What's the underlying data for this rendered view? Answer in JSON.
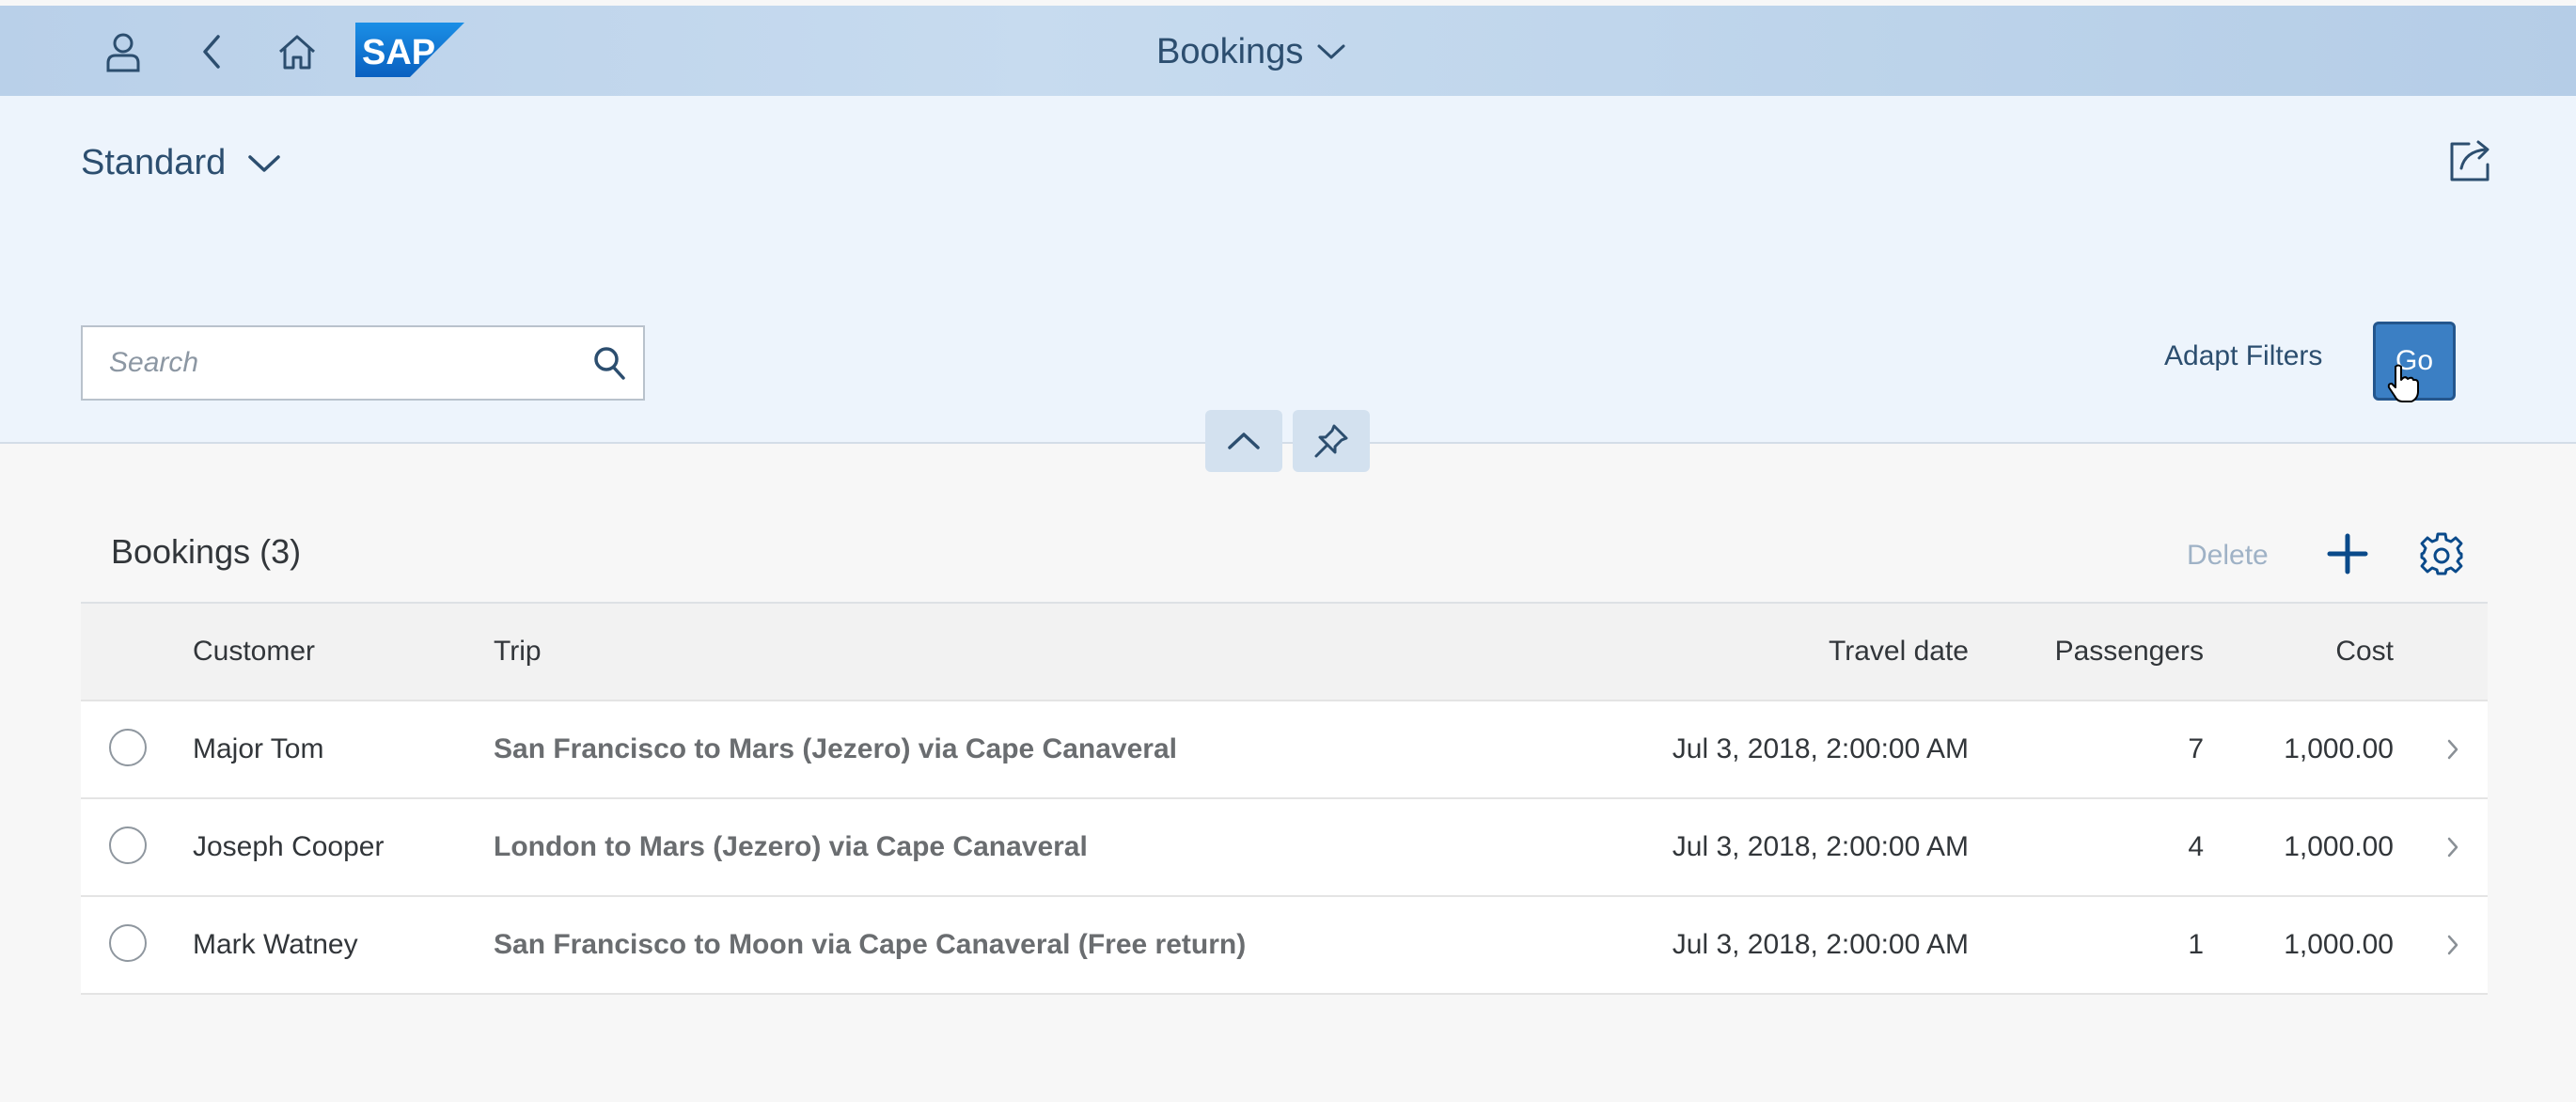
{
  "shell": {
    "logo_text": "SAP",
    "title": "Bookings",
    "icons": {
      "user": "user-icon",
      "back": "back-icon",
      "home": "home-icon",
      "title_dropdown": "chevron-down-icon"
    }
  },
  "header": {
    "variant_label": "Standard",
    "share_icon": "share-icon",
    "search": {
      "placeholder": "Search",
      "value": ""
    },
    "adapt_filters_label": "Adapt Filters",
    "go_label": "Go",
    "collapse_icon": "chevron-up-icon",
    "pin_icon": "pin-icon"
  },
  "table": {
    "title": "Bookings (3)",
    "delete_label": "Delete",
    "add_icon": "add-icon",
    "settings_icon": "gear-icon",
    "columns": {
      "customer": "Customer",
      "trip": "Trip",
      "travel_date": "Travel date",
      "passengers": "Passengers",
      "cost": "Cost"
    },
    "rows": [
      {
        "customer": "Major Tom",
        "trip": "San Francisco to Mars (Jezero) via Cape Canaveral",
        "travel_date": "Jul 3, 2018, 2:00:00 AM",
        "passengers": "7",
        "cost": "1,000.00"
      },
      {
        "customer": "Joseph Cooper",
        "trip": "London to Mars (Jezero) via Cape Canaveral",
        "travel_date": "Jul 3, 2018, 2:00:00 AM",
        "passengers": "4",
        "cost": "1,000.00"
      },
      {
        "customer": "Mark Watney",
        "trip": "San Francisco to Moon via Cape Canaveral (Free return)",
        "travel_date": "Jul 3, 2018, 2:00:00 AM",
        "passengers": "1",
        "cost": "1,000.00"
      }
    ]
  },
  "colors": {
    "shell_background": "#c7dbef",
    "header_background": "#edf4fc",
    "brand_blue": "#0a6ed1",
    "emphasized_button": "#3b7fc4",
    "text_link": "#2c4e6f"
  }
}
